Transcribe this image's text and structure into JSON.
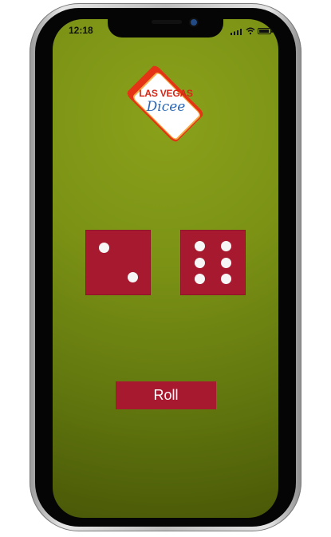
{
  "status_bar": {
    "time": "12:18"
  },
  "logo": {
    "top_text": "LAS VEGAS",
    "bottom_text": "Dicee"
  },
  "dice": {
    "left_value": 2,
    "right_value": 6,
    "color": "#a7192f",
    "pip_color": "#f6f6f6"
  },
  "actions": {
    "roll_label": "Roll"
  },
  "colors": {
    "felt_green": "#7b9215",
    "button_red": "#a7192f"
  }
}
